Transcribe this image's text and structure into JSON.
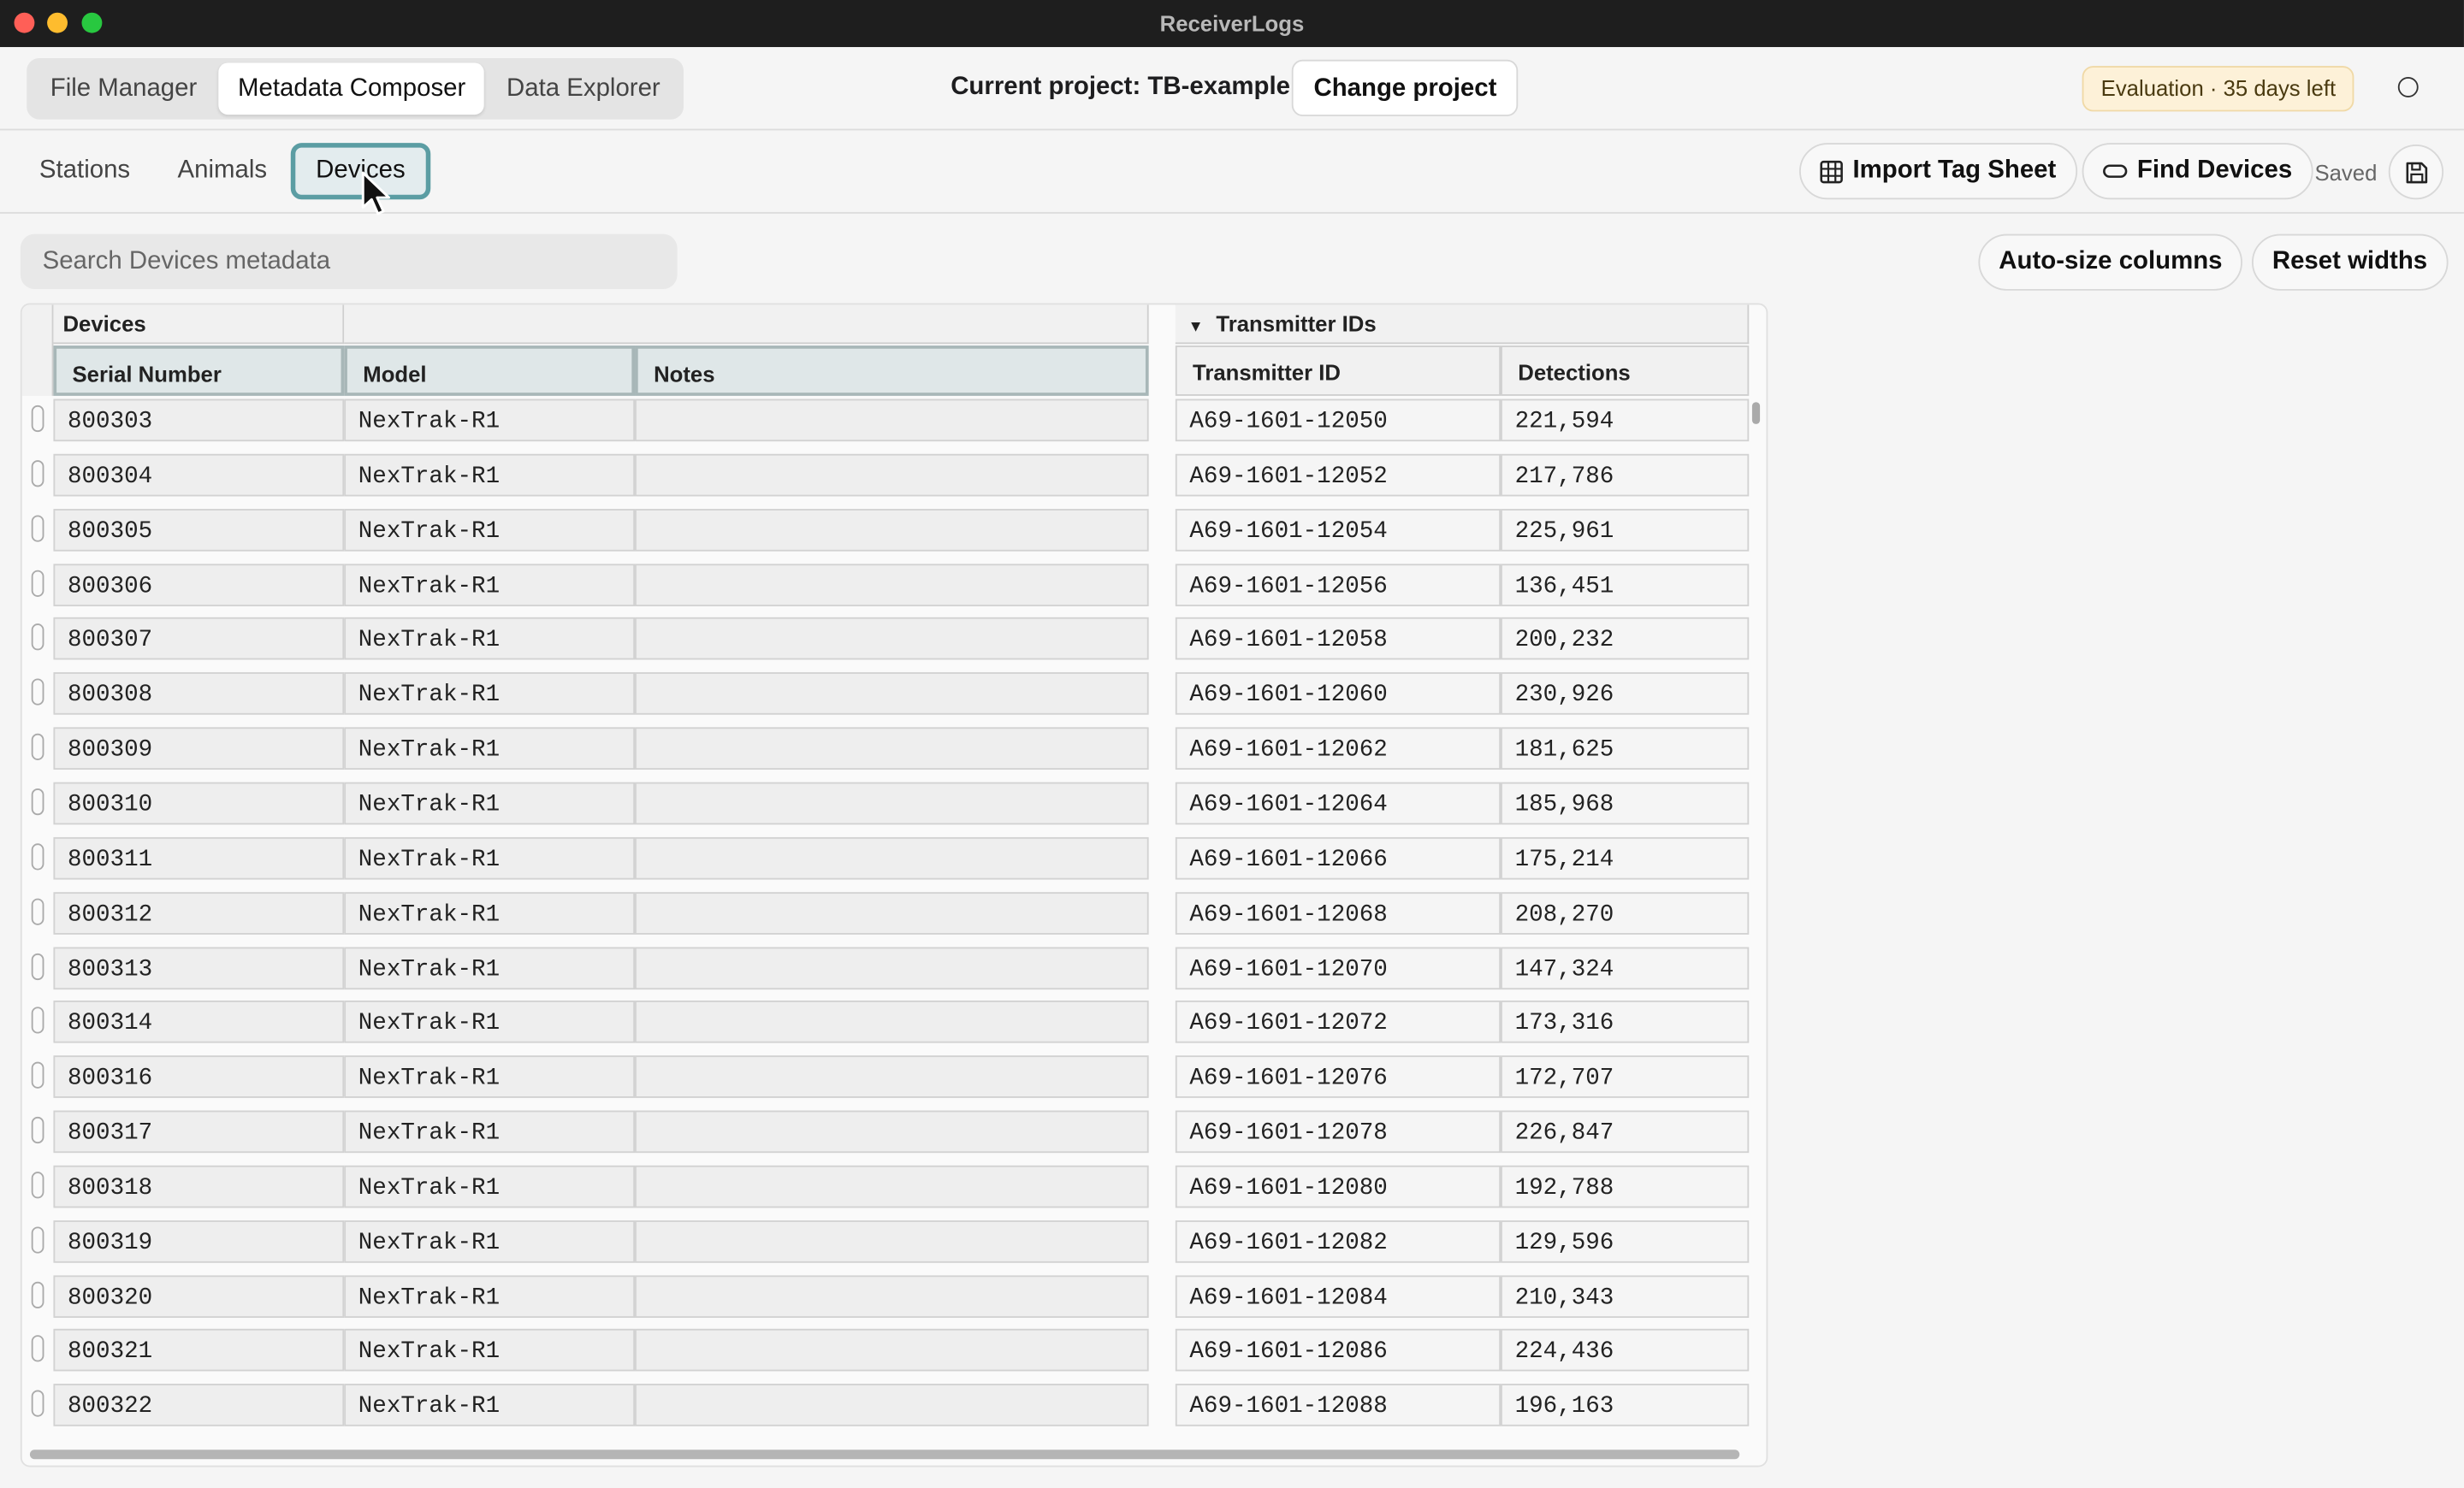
{
  "app": {
    "title": "ReceiverLogs"
  },
  "nav": {
    "tabs": [
      "File Manager",
      "Metadata Composer",
      "Data Explorer"
    ],
    "active_tab": "Metadata Composer"
  },
  "project": {
    "label": "Current project: TB-example",
    "change_button": "Change project"
  },
  "license": {
    "badge": "Evaluation · 35 days left"
  },
  "subnav": {
    "tabs": [
      "Stations",
      "Animals",
      "Devices"
    ],
    "active_tab": "Devices",
    "import_button": "Import Tag Sheet",
    "find_button": "Find Devices",
    "saved_status": "Saved"
  },
  "search": {
    "placeholder": "Search Devices metadata"
  },
  "grid_actions": {
    "autosize": "Auto-size columns",
    "reset": "Reset widths"
  },
  "table": {
    "groups": {
      "devices": "Devices",
      "transmitters": "Transmitter IDs"
    },
    "columns": {
      "serial": "Serial Number",
      "model": "Model",
      "notes": "Notes",
      "transmitter": "Transmitter ID",
      "detections": "Detections"
    },
    "rows": [
      {
        "serial": "800303",
        "model": "NexTrak-R1",
        "notes": "",
        "transmitter": "A69-1601-12050",
        "detections": "221,594"
      },
      {
        "serial": "800304",
        "model": "NexTrak-R1",
        "notes": "",
        "transmitter": "A69-1601-12052",
        "detections": "217,786"
      },
      {
        "serial": "800305",
        "model": "NexTrak-R1",
        "notes": "",
        "transmitter": "A69-1601-12054",
        "detections": "225,961"
      },
      {
        "serial": "800306",
        "model": "NexTrak-R1",
        "notes": "",
        "transmitter": "A69-1601-12056",
        "detections": "136,451"
      },
      {
        "serial": "800307",
        "model": "NexTrak-R1",
        "notes": "",
        "transmitter": "A69-1601-12058",
        "detections": "200,232"
      },
      {
        "serial": "800308",
        "model": "NexTrak-R1",
        "notes": "",
        "transmitter": "A69-1601-12060",
        "detections": "230,926"
      },
      {
        "serial": "800309",
        "model": "NexTrak-R1",
        "notes": "",
        "transmitter": "A69-1601-12062",
        "detections": "181,625"
      },
      {
        "serial": "800310",
        "model": "NexTrak-R1",
        "notes": "",
        "transmitter": "A69-1601-12064",
        "detections": "185,968"
      },
      {
        "serial": "800311",
        "model": "NexTrak-R1",
        "notes": "",
        "transmitter": "A69-1601-12066",
        "detections": "175,214"
      },
      {
        "serial": "800312",
        "model": "NexTrak-R1",
        "notes": "",
        "transmitter": "A69-1601-12068",
        "detections": "208,270"
      },
      {
        "serial": "800313",
        "model": "NexTrak-R1",
        "notes": "",
        "transmitter": "A69-1601-12070",
        "detections": "147,324"
      },
      {
        "serial": "800314",
        "model": "NexTrak-R1",
        "notes": "",
        "transmitter": "A69-1601-12072",
        "detections": "173,316"
      },
      {
        "serial": "800316",
        "model": "NexTrak-R1",
        "notes": "",
        "transmitter": "A69-1601-12076",
        "detections": "172,707"
      },
      {
        "serial": "800317",
        "model": "NexTrak-R1",
        "notes": "",
        "transmitter": "A69-1601-12078",
        "detections": "226,847"
      },
      {
        "serial": "800318",
        "model": "NexTrak-R1",
        "notes": "",
        "transmitter": "A69-1601-12080",
        "detections": "192,788"
      },
      {
        "serial": "800319",
        "model": "NexTrak-R1",
        "notes": "",
        "transmitter": "A69-1601-12082",
        "detections": "129,596"
      },
      {
        "serial": "800320",
        "model": "NexTrak-R1",
        "notes": "",
        "transmitter": "A69-1601-12084",
        "detections": "210,343"
      },
      {
        "serial": "800321",
        "model": "NexTrak-R1",
        "notes": "",
        "transmitter": "A69-1601-12086",
        "detections": "224,436"
      },
      {
        "serial": "800322",
        "model": "NexTrak-R1",
        "notes": "",
        "transmitter": "A69-1601-12088",
        "detections": "196,163"
      }
    ]
  },
  "icons": {
    "import": "table-icon",
    "find": "tag-icon",
    "save": "floppy-disk-icon",
    "collapse": "triangle-down-icon",
    "status": "circle-status-icon",
    "cursor": "mouse-pointer-icon"
  },
  "colors": {
    "accent": "#5b9da3",
    "badge_bg": "#fdf1d8",
    "titlebar": "#1e1e1e"
  }
}
